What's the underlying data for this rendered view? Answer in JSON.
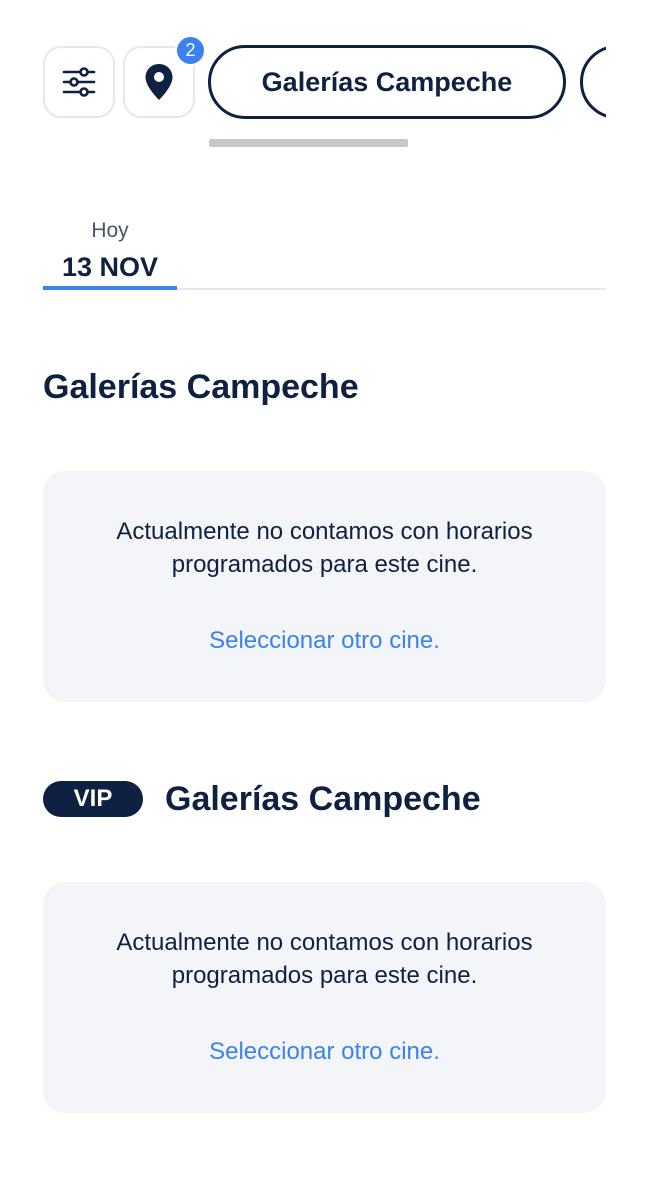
{
  "filters": {
    "location_count": "2",
    "cinemas": [
      "Galerías Campeche"
    ]
  },
  "dates": [
    {
      "day": "Hoy",
      "date": "13 NOV",
      "selected": true
    }
  ],
  "sections": [
    {
      "vip": false,
      "title": "Galerías Campeche",
      "message": "Actualmente no contamos con horarios programados para este cine.",
      "link": "Seleccionar otro cine."
    },
    {
      "vip": true,
      "badge": "VIP",
      "title": "Galerías Campeche",
      "message": "Actualmente no contamos con horarios programados para este cine.",
      "link": "Seleccionar otro cine."
    }
  ],
  "colors": {
    "navy": "#0f2140",
    "accent_blue": "#3b82f0",
    "card_bg": "#f3f5f8"
  }
}
